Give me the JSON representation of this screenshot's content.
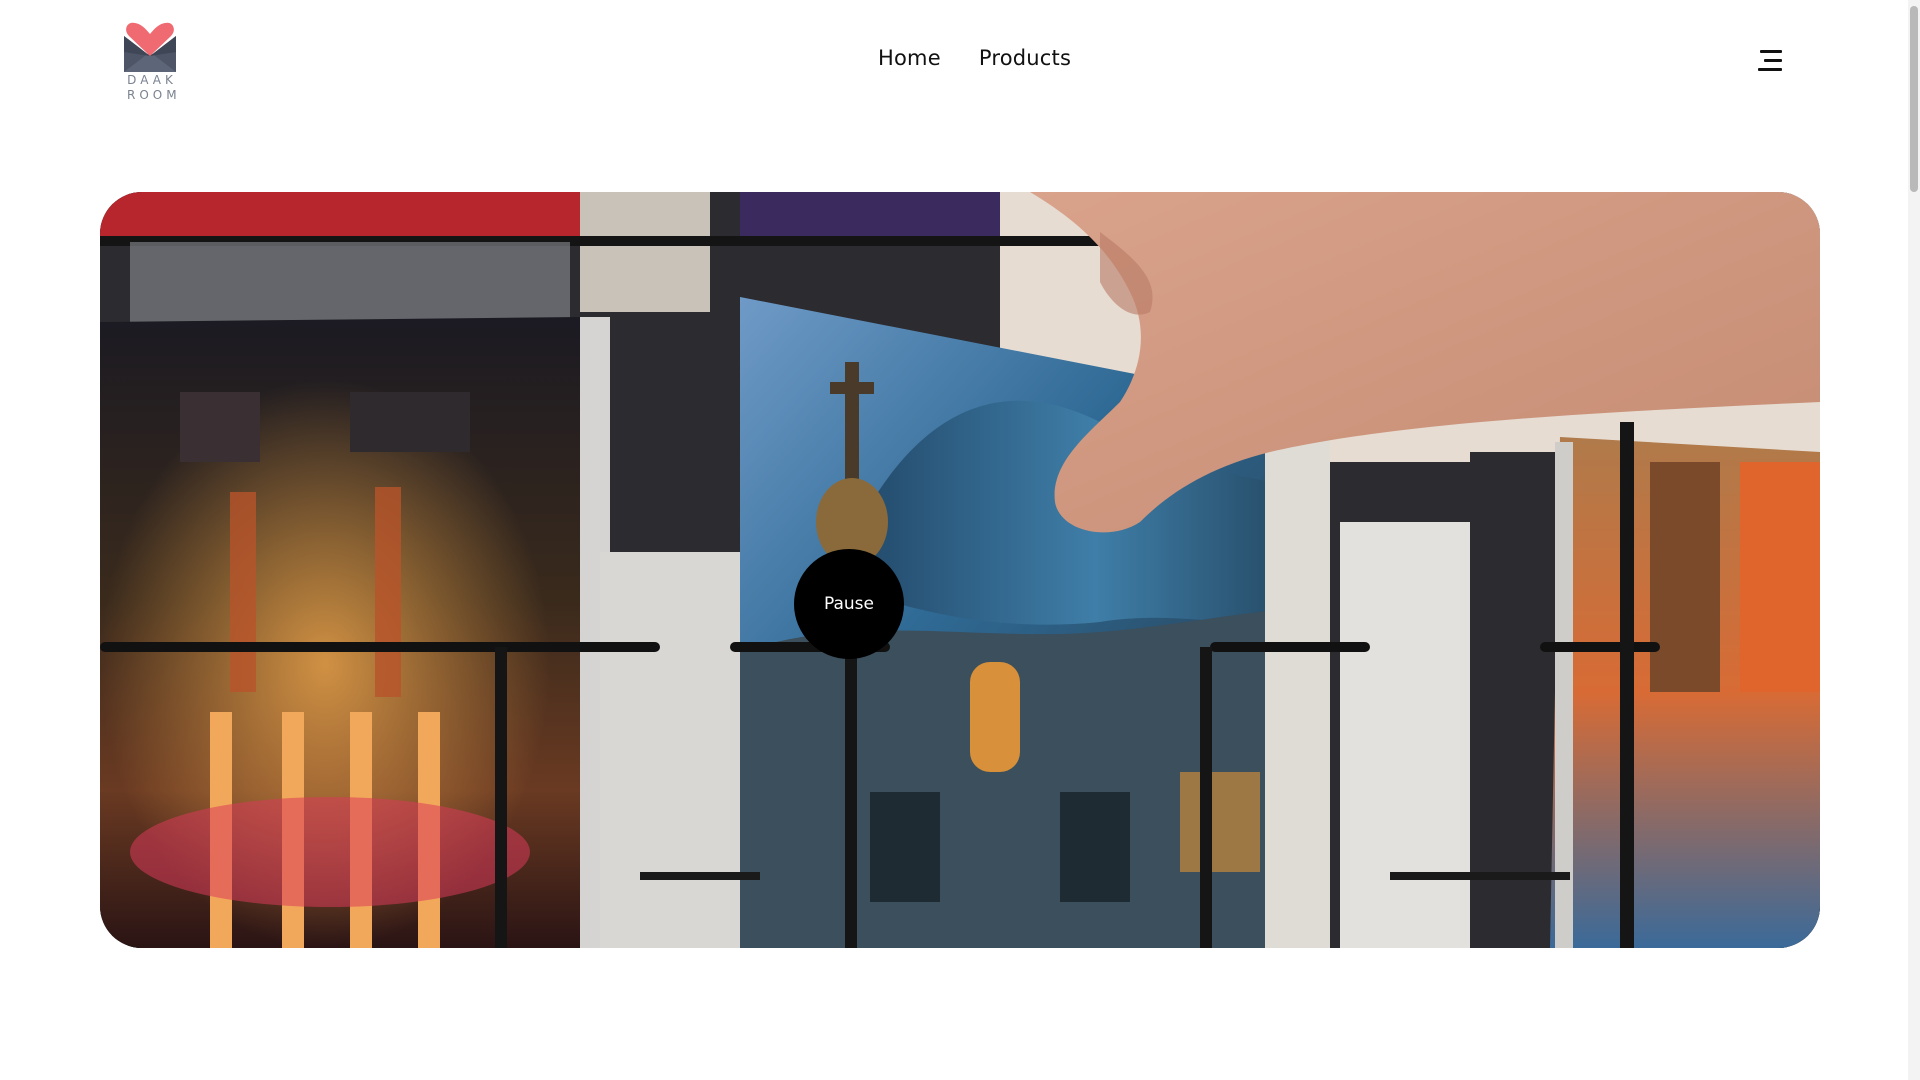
{
  "brand": {
    "logo_line1": "DAAK",
    "logo_line2": "ROOM",
    "logo_icon": "envelope-heart-icon",
    "accent_color": "#f06a72",
    "secondary_color": "#4d5566"
  },
  "nav": {
    "items": [
      {
        "label": "Home"
      },
      {
        "label": "Products"
      }
    ]
  },
  "menu": {
    "icon": "hamburger-menu-icon"
  },
  "hero": {
    "media_type": "video",
    "pause_label": "Pause"
  }
}
